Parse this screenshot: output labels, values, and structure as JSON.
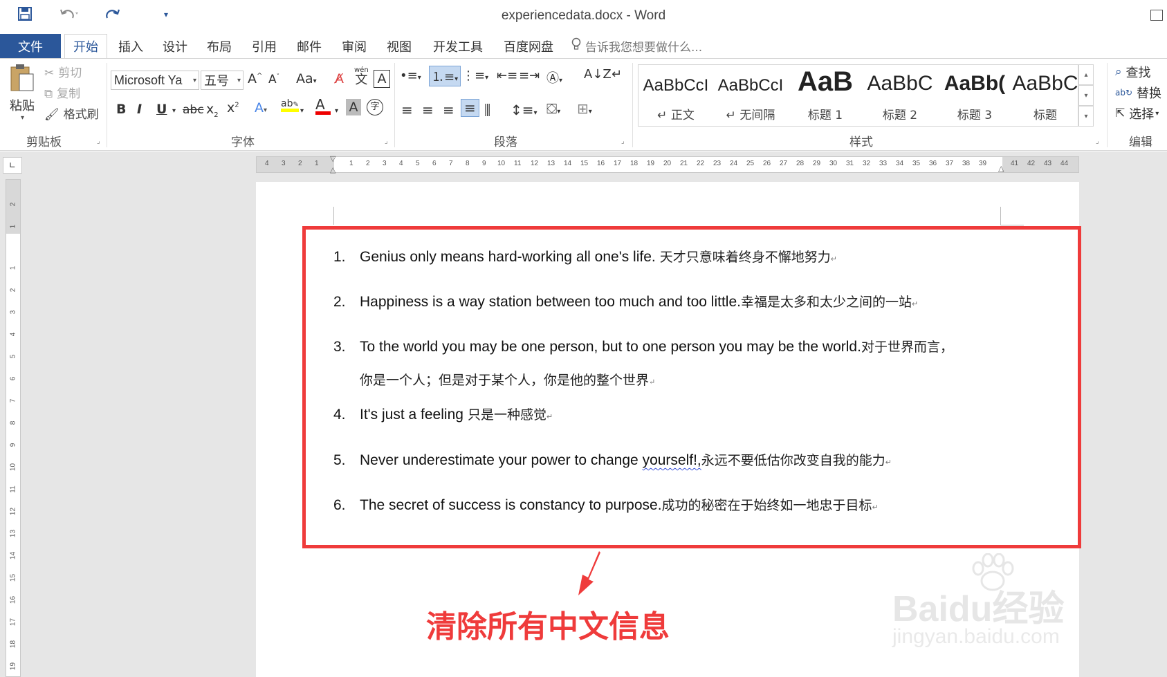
{
  "title_bar": {
    "title": "experiencedata.docx - Word"
  },
  "tabs": {
    "file": "文件",
    "items": [
      "开始",
      "插入",
      "设计",
      "布局",
      "引用",
      "邮件",
      "审阅",
      "视图",
      "开发工具",
      "百度网盘"
    ],
    "active": "开始",
    "tell_me": "告诉我您想要做什么..."
  },
  "ribbon": {
    "clipboard": {
      "paste": "粘贴",
      "cut": "剪切",
      "copy": "复制",
      "format_painter": "格式刷",
      "label": "剪贴板"
    },
    "font": {
      "font_name": "Microsoft Ya",
      "font_size": "五号",
      "change_case": "Aa",
      "label": "字体",
      "pinyin": "wén",
      "pinyin_char": "文"
    },
    "paragraph": {
      "label": "段落"
    },
    "styles": {
      "label": "样式",
      "items": [
        {
          "sample": "AaBbCcI",
          "name": "↵ 正文"
        },
        {
          "sample": "AaBbCcI",
          "name": "↵ 无间隔"
        },
        {
          "sample": "AaB",
          "name": "标题 1"
        },
        {
          "sample": "AaBbC",
          "name": "标题 2"
        },
        {
          "sample": "AaBb(",
          "name": "标题 3"
        },
        {
          "sample": "AaBbC",
          "name": "标题"
        }
      ]
    },
    "editing": {
      "find": "查找",
      "replace": "替换",
      "select": "选择",
      "label": "编辑"
    }
  },
  "ruler": {
    "h_ticks_left": [
      "4",
      "3",
      "2",
      "1"
    ],
    "h_ticks": [
      "1",
      "2",
      "3",
      "4",
      "5",
      "6",
      "7",
      "8",
      "9",
      "10",
      "11",
      "12",
      "13",
      "14",
      "15",
      "16",
      "17",
      "18",
      "19",
      "20",
      "21",
      "22",
      "23",
      "24",
      "25",
      "26",
      "27",
      "28",
      "29",
      "30",
      "31",
      "32",
      "33",
      "34",
      "35",
      "36",
      "37",
      "38",
      "39"
    ],
    "h_ticks_right": [
      "41",
      "42",
      "43",
      "44"
    ],
    "v_ticks_top": [
      "2",
      "1"
    ],
    "v_ticks": [
      "1",
      "2",
      "3",
      "4",
      "5",
      "6",
      "7",
      "8",
      "9",
      "10",
      "11",
      "12",
      "13",
      "14",
      "15",
      "16",
      "17",
      "18",
      "19"
    ]
  },
  "document": {
    "items": [
      {
        "num": "1.",
        "en": "Genius only means hard-working all one's life.",
        "cn": " 天才只意味着终身不懈地努力"
      },
      {
        "num": "2.",
        "en": "Happiness is a way station between too much and too little.",
        "cn": "幸福是太多和太少之间的一站"
      },
      {
        "num": "3.",
        "en": "To the world you may be one person, but to one person you may be the world.",
        "cn": "对于世界而言，"
      },
      {
        "num": "4.",
        "en": "It's just a feeling",
        "cn": " 只是一种感觉"
      },
      {
        "num": "5.",
        "en_before": "Never underestimate your power to change ",
        "en_squiggle": "yourself!,",
        "cn": "永远不要低估你改变自我的能力"
      },
      {
        "num": "6.",
        "en": "The secret of success is constancy to purpose.",
        "cn": "成功的秘密在于始终如一地忠于目标"
      }
    ],
    "item3_continuation": "你是一个人；但是对于某个人，你是他的整个世界",
    "para_mark": "↵"
  },
  "annotation": {
    "text": "清除所有中文信息",
    "color": "#ef3b3b"
  },
  "watermark": {
    "main": "Baidu经验",
    "sub": "jingyan.baidu.com"
  },
  "colors": {
    "accent": "#2b579a",
    "highlight_border": "#ef3b3b"
  }
}
